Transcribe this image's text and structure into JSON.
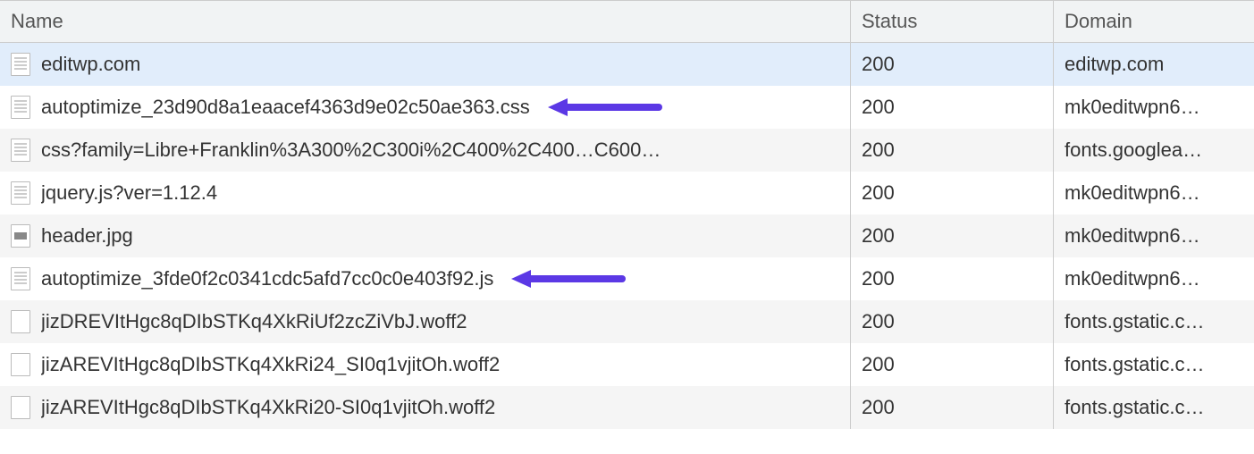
{
  "columns": {
    "name": "Name",
    "status": "Status",
    "domain": "Domain"
  },
  "annotation_color": "#5b38e5",
  "rows": [
    {
      "name": "editwp.com",
      "status": "200",
      "domain": "editwp.com",
      "icon": "doc",
      "selected": true,
      "arrow": false
    },
    {
      "name": "autoptimize_23d90d8a1eaacef4363d9e02c50ae363.css",
      "status": "200",
      "domain": "mk0editwpn6…",
      "icon": "doc",
      "selected": false,
      "arrow": true
    },
    {
      "name": "css?family=Libre+Franklin%3A300%2C300i%2C400%2C400…C600…",
      "status": "200",
      "domain": "fonts.googlea…",
      "icon": "doc",
      "selected": false,
      "arrow": false
    },
    {
      "name": "jquery.js?ver=1.12.4",
      "status": "200",
      "domain": "mk0editwpn6…",
      "icon": "doc",
      "selected": false,
      "arrow": false
    },
    {
      "name": "header.jpg",
      "status": "200",
      "domain": "mk0editwpn6…",
      "icon": "img",
      "selected": false,
      "arrow": false
    },
    {
      "name": "autoptimize_3fde0f2c0341cdc5afd7cc0c0e403f92.js",
      "status": "200",
      "domain": "mk0editwpn6…",
      "icon": "doc",
      "selected": false,
      "arrow": true
    },
    {
      "name": "jizDREVItHgc8qDIbSTKq4XkRiUf2zcZiVbJ.woff2",
      "status": "200",
      "domain": "fonts.gstatic.c…",
      "icon": "font",
      "selected": false,
      "arrow": false
    },
    {
      "name": "jizAREVItHgc8qDIbSTKq4XkRi24_SI0q1vjitOh.woff2",
      "status": "200",
      "domain": "fonts.gstatic.c…",
      "icon": "font",
      "selected": false,
      "arrow": false
    },
    {
      "name": "jizAREVItHgc8qDIbSTKq4XkRi20-SI0q1vjitOh.woff2",
      "status": "200",
      "domain": "fonts.gstatic.c…",
      "icon": "font",
      "selected": false,
      "arrow": false
    }
  ]
}
